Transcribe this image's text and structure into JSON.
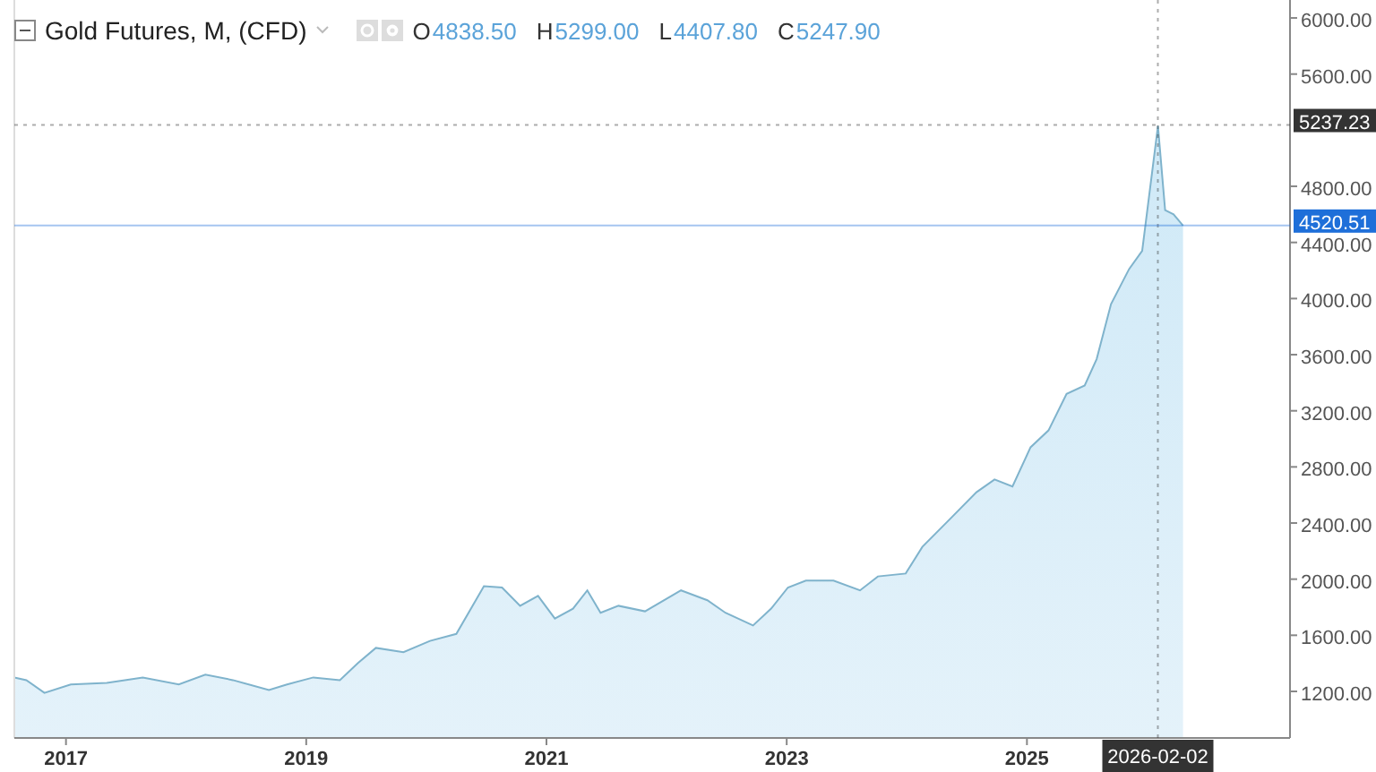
{
  "header": {
    "title": "Gold Futures, M, (CFD)",
    "ohlc": [
      {
        "label": "O",
        "value": "4838.50"
      },
      {
        "label": "H",
        "value": "5299.00"
      },
      {
        "label": "L",
        "value": "4407.80"
      },
      {
        "label": "C",
        "value": "5247.90"
      }
    ]
  },
  "chart": {
    "chart_data": {
      "type": "area",
      "xlim": [
        2016.57,
        2027.19
      ],
      "ylim": [
        868,
        6128
      ],
      "xticks": [
        {
          "value": 2017,
          "label": "2017"
        },
        {
          "value": 2019,
          "label": "2019"
        },
        {
          "value": 2021,
          "label": "2021"
        },
        {
          "value": 2023,
          "label": "2023"
        },
        {
          "value": 2025,
          "label": "2025"
        }
      ],
      "yticks": [
        {
          "value": 1200,
          "label": "1200.00"
        },
        {
          "value": 1600,
          "label": "1600.00"
        },
        {
          "value": 2000,
          "label": "2000.00"
        },
        {
          "value": 2400,
          "label": "2400.00"
        },
        {
          "value": 2800,
          "label": "2800.00"
        },
        {
          "value": 3200,
          "label": "3200.00"
        },
        {
          "value": 3600,
          "label": "3600.00"
        },
        {
          "value": 4000,
          "label": "4000.00"
        },
        {
          "value": 4400,
          "label": "4400.00"
        },
        {
          "value": 4800,
          "label": "4800.00"
        },
        {
          "value": 5600,
          "label": "5600.00"
        },
        {
          "value": 6000,
          "label": "6000.00"
        }
      ],
      "x": [
        2016.57,
        2016.67,
        2016.82,
        2017.04,
        2017.34,
        2017.64,
        2017.94,
        2018.16,
        2018.39,
        2018.69,
        2018.84,
        2019.06,
        2019.28,
        2019.43,
        2019.58,
        2019.81,
        2020.03,
        2020.25,
        2020.48,
        2020.63,
        2020.78,
        2020.93,
        2021.07,
        2021.22,
        2021.34,
        2021.45,
        2021.6,
        2021.82,
        2022.12,
        2022.34,
        2022.49,
        2022.72,
        2022.87,
        2023.01,
        2023.16,
        2023.39,
        2023.61,
        2023.76,
        2023.99,
        2024.13,
        2024.36,
        2024.58,
        2024.73,
        2024.88,
        2025.03,
        2025.18,
        2025.33,
        2025.48,
        2025.58,
        2025.7,
        2025.85,
        2025.96,
        2026.09,
        2026.15,
        2026.22,
        2026.3
      ],
      "series": [
        {
          "color": "#7fb3cc",
          "values": [
            1300,
            1280,
            1190,
            1250,
            1260,
            1300,
            1250,
            1320,
            1280,
            1210,
            1250,
            1300,
            1280,
            1400,
            1510,
            1480,
            1560,
            1610,
            1950,
            1940,
            1810,
            1880,
            1720,
            1790,
            1920,
            1760,
            1810,
            1770,
            1920,
            1850,
            1760,
            1670,
            1790,
            1940,
            1990,
            1990,
            1920,
            2020,
            2040,
            2230,
            2430,
            2620,
            2710,
            2660,
            2940,
            3060,
            3320,
            3380,
            3570,
            3960,
            4210,
            4340,
            5230,
            4630,
            4600,
            4520
          ]
        }
      ],
      "ref_lines": [
        {
          "axis": "y",
          "value": 5237.23,
          "label": "5237.23",
          "color": "#333333"
        },
        {
          "axis": "x",
          "value": 2026.09,
          "label": "2026-02-02",
          "color": "#333333"
        },
        {
          "axis": "y",
          "value": 4520.51,
          "label": "4520.51",
          "color": "#1e6fd9"
        }
      ]
    }
  }
}
